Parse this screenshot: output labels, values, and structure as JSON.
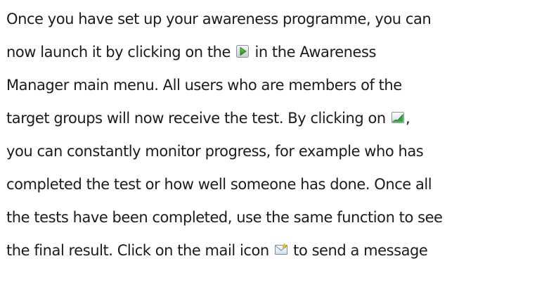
{
  "document": {
    "lines": [
      {
        "text": "Once you have set up your awareness programme, you can"
      },
      {
        "before": "now launch it by clicking on the ",
        "icon": "play-icon",
        "after": " in the Awareness"
      },
      {
        "text": "Manager main menu. All users who are members of the"
      },
      {
        "before": "target groups will now receive the test. By clicking on ",
        "icon": "chart-icon",
        "after": ","
      },
      {
        "text": "you can constantly monitor progress, for example who has"
      },
      {
        "text": "completed the test or how well someone has done. Once all"
      },
      {
        "text": "the tests have been completed, use the same function to see"
      },
      {
        "before": "the final result. Click on the mail icon ",
        "icon": "mail-icon",
        "after": " to send a message"
      }
    ]
  },
  "colors": {
    "text": "#1b1b1b",
    "play_icon_green": "#2e9a1c",
    "chart_icon_green": "#2aa63a",
    "mail_icon_yellow": "#f2c21a"
  }
}
